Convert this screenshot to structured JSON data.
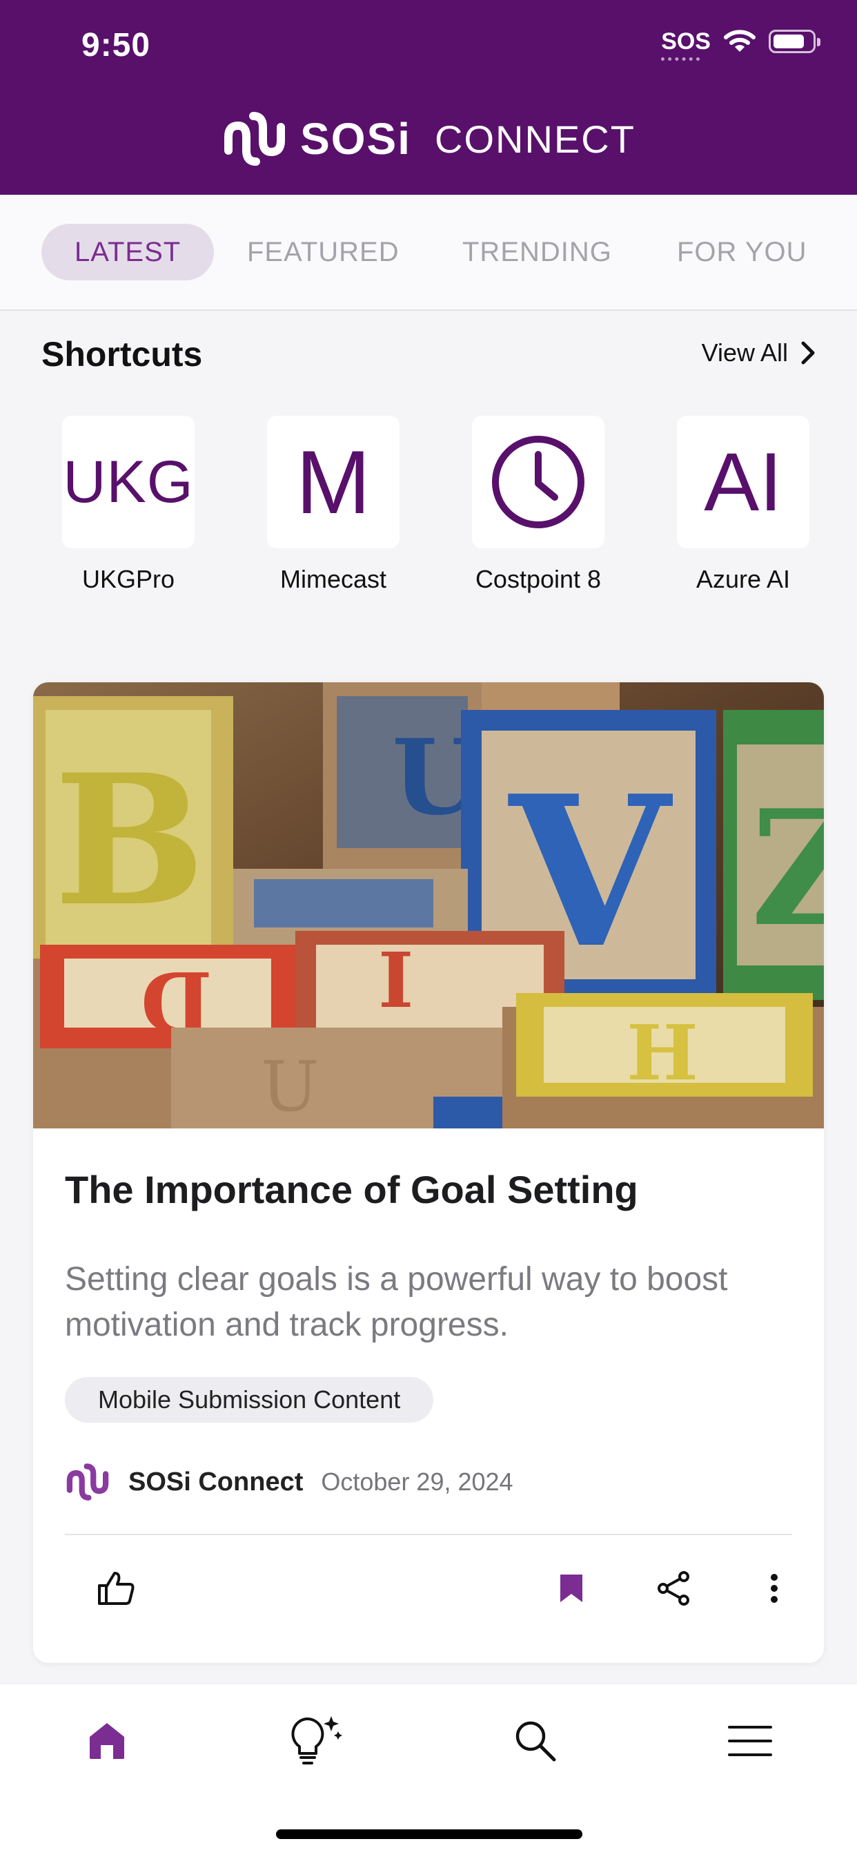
{
  "status_bar": {
    "time": "9:50",
    "sos": "SOS"
  },
  "brand": {
    "name": "SOSi",
    "suffix": "CONNECT",
    "color": "#58106b"
  },
  "tabs": [
    {
      "label": "LATEST",
      "active": true
    },
    {
      "label": "FEATURED",
      "active": false
    },
    {
      "label": "TRENDING",
      "active": false
    },
    {
      "label": "FOR YOU",
      "active": false
    }
  ],
  "shortcuts": {
    "title": "Shortcuts",
    "view_all": "View All",
    "items": [
      {
        "tile_text": "UKG",
        "label": "UKGPro"
      },
      {
        "tile_text": "M",
        "label": "Mimecast"
      },
      {
        "icon": "clock-icon",
        "label": "Costpoint 8"
      },
      {
        "tile_text": "AI",
        "label": "Azure AI"
      }
    ]
  },
  "article": {
    "image_description": "wooden alphabet blocks",
    "title": "The Importance of Goal Setting",
    "description": "Setting clear goals is a powerful way to boost motivation and track progress.",
    "tag": "Mobile Submission Content",
    "author": "SOSi Connect",
    "date": "October 29, 2024",
    "actions": [
      "like-icon",
      "bookmark-icon",
      "share-icon",
      "more-icon"
    ]
  },
  "bottom_nav": [
    "home-icon",
    "ideas-icon",
    "search-icon",
    "menu-icon"
  ],
  "colors": {
    "accent": "#7b2d91",
    "header": "#58106b"
  }
}
